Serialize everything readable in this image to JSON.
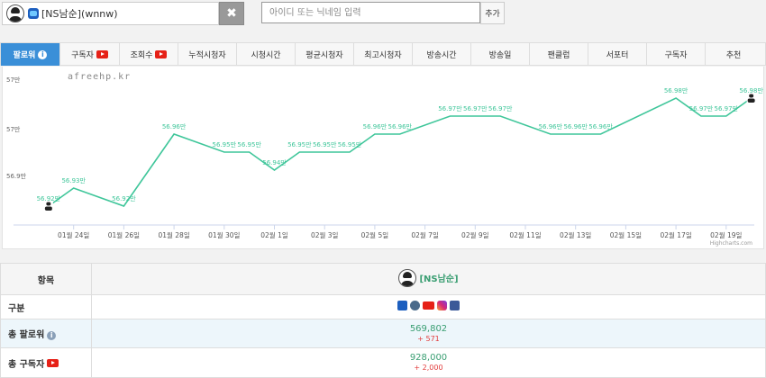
{
  "topbar": {
    "channel_label": "[NS남순](wnnw)",
    "clear_icon": "✖",
    "search_placeholder": "아이디 또는 닉네임 입력",
    "add_label": "추가"
  },
  "tabs": [
    {
      "label": "팔로워",
      "active": true,
      "icon": "info"
    },
    {
      "label": "구독자",
      "active": false,
      "icon": "youtube"
    },
    {
      "label": "조회수",
      "active": false,
      "icon": "youtube"
    },
    {
      "label": "누적시청자",
      "active": false,
      "icon": ""
    },
    {
      "label": "시청시간",
      "active": false,
      "icon": ""
    },
    {
      "label": "평균시청자",
      "active": false,
      "icon": ""
    },
    {
      "label": "최고시청자",
      "active": false,
      "icon": ""
    },
    {
      "label": "방송시간",
      "active": false,
      "icon": ""
    },
    {
      "label": "방송일",
      "active": false,
      "icon": ""
    },
    {
      "label": "팬클럽",
      "active": false,
      "icon": ""
    },
    {
      "label": "서포터",
      "active": false,
      "icon": ""
    },
    {
      "label": "구독자",
      "active": false,
      "icon": ""
    },
    {
      "label": "추천",
      "active": false,
      "icon": ""
    }
  ],
  "chart": {
    "watermark": "afreehp.kr",
    "credit": "Highcharts.com",
    "line_color": "#3fc69a",
    "y_tick_labels": [
      "57만",
      "57만",
      "56.9만"
    ],
    "x_tick_labels": [
      "01월 24일",
      "01월 26일",
      "01월 28일",
      "01월 30일",
      "02월 1일",
      "02월 3일",
      "02월 5일",
      "02월 7일",
      "02월 9일",
      "02월 11일",
      "02월 13일",
      "02월 15일",
      "02월 17일",
      "02월 19일"
    ]
  },
  "chart_data": {
    "type": "line",
    "title": "",
    "xlabel": "",
    "ylabel": "",
    "x": [
      "01월 23일",
      "01월 24일",
      "01월 26일",
      "01월 28일",
      "01월 30일",
      "01월 31일",
      "02월 1일",
      "02월 2일",
      "02월 3일",
      "02월 4일",
      "02월 5일",
      "02월 6일",
      "02월 8일",
      "02월 9일",
      "02월 10일",
      "02월 12일",
      "02월 13일",
      "02월 14일",
      "02월 17일",
      "02월 18일",
      "02월 19일",
      "02월 20일"
    ],
    "series": [
      {
        "values": [
          56.92,
          56.93,
          56.92,
          56.96,
          56.95,
          56.95,
          56.94,
          56.95,
          56.95,
          56.95,
          56.96,
          56.96,
          56.97,
          56.97,
          56.97,
          56.96,
          56.96,
          56.96,
          56.98,
          56.97,
          56.97,
          56.98
        ],
        "labels": [
          "56.92만",
          "56.93만",
          "56.92만",
          "56.96만",
          "56.95만",
          "56.95만",
          "56.94만",
          "56.95만",
          "56.95만",
          "56.95만",
          "56.96만",
          "56.96만",
          "56.97만",
          "56.97만",
          "56.97만",
          "56.96만",
          "56.96만",
          "56.96만",
          "56.98만",
          "56.97만",
          "56.97만",
          "56.98만"
        ]
      }
    ],
    "legend": "none",
    "grid": false
  },
  "table": {
    "header_label": "항목",
    "streamer_name": "[NS남순]",
    "rows": {
      "gubun": {
        "label": "구분"
      },
      "followers": {
        "label": "총 팔로워",
        "value": "569,802",
        "delta": "+ 571"
      },
      "subscribers": {
        "label": "총 구독자",
        "value": "928,000",
        "delta": "+ 2,000"
      }
    }
  }
}
